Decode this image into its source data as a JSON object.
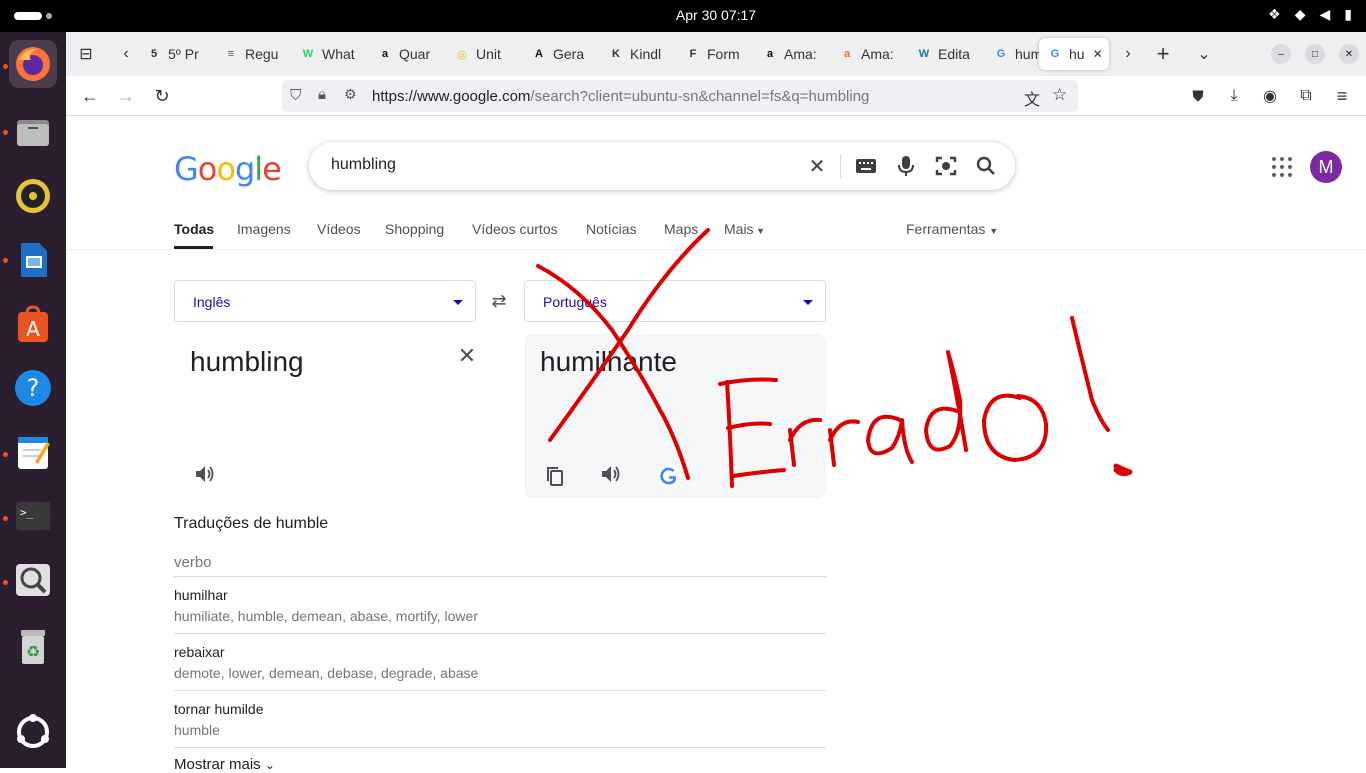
{
  "system": {
    "clock": "Apr 30  07:17",
    "tray_icons": [
      "dropbox-icon",
      "wifi-icon",
      "volume-icon",
      "battery-icon"
    ]
  },
  "dock": {
    "apps": [
      "firefox-icon",
      "files-icon",
      "rhythmbox-icon",
      "writer-icon",
      "app-center-icon",
      "help-icon",
      "text-editor-icon",
      "terminal-icon",
      "image-viewer-icon",
      "trash-icon",
      "show-apps-icon"
    ]
  },
  "browser": {
    "tabs": [
      {
        "label": "5º Pr",
        "favicon": "5"
      },
      {
        "label": "Regu",
        "favicon": "≡"
      },
      {
        "label": "What",
        "favicon": "W"
      },
      {
        "label": "Quar",
        "favicon": "a"
      },
      {
        "label": "Unit",
        "favicon": "◎"
      },
      {
        "label": "Gera",
        "favicon": "A"
      },
      {
        "label": "Kindl",
        "favicon": "K"
      },
      {
        "label": "Form",
        "favicon": "F"
      },
      {
        "label": "Ama:",
        "favicon": "a"
      },
      {
        "label": "Ama:",
        "favicon": "a"
      },
      {
        "label": "Edita",
        "favicon": "W"
      },
      {
        "label": "humi",
        "favicon": "G"
      },
      {
        "label": "hu",
        "favicon": "G",
        "active": true
      }
    ],
    "url": {
      "prefix": "https://www.google.com",
      "rest": "/search?client=ubuntu-sn&channel=fs&q=humbling"
    }
  },
  "google": {
    "logo": "Google",
    "query": "humbling",
    "avatar_letter": "M",
    "nav_tabs": [
      "Todas",
      "Imagens",
      "Vídeos",
      "Shopping",
      "Vídeos curtos",
      "Notícias",
      "Maps",
      "Mais"
    ],
    "tools_label": "Ferramentas"
  },
  "translate": {
    "source_lang": "Inglês",
    "target_lang": "Português",
    "source_text": "humbling",
    "target_text": "humilhante"
  },
  "dictionary": {
    "title": "Traduções de humble",
    "part_of_speech": "verbo",
    "entries": [
      {
        "word": "humilhar",
        "synonyms": "humiliate, humble, demean, abase, mortify, lower"
      },
      {
        "word": "rebaixar",
        "synonyms": "demote, lower, demean, debase, degrade, abase"
      },
      {
        "word": "tornar humilde",
        "synonyms": "humble"
      }
    ],
    "more_label": "Mostrar mais"
  },
  "annotation": {
    "text": "Errado!",
    "color": "#dd0000"
  }
}
